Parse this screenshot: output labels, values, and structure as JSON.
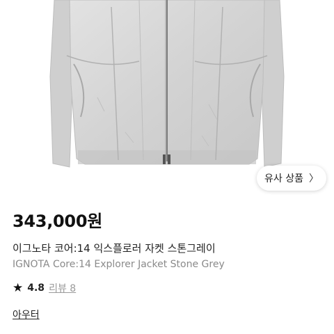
{
  "product": {
    "image_alt": "product-photo",
    "price": "343,000원",
    "title_ko": "이그노타 코어:14 익스플로러 자켓 스톤그레이",
    "title_en": "IGNOTA Core:14 Explorer Jacket Stone Grey",
    "rating": "4.8",
    "reviews_label": "리뷰 8",
    "category": "아우터"
  },
  "similar_button": {
    "label": "유사 상품",
    "icon": "chevron-right-icon"
  },
  "colors": {
    "jacket": "#d9d9d9",
    "text_primary": "#111111",
    "text_secondary": "#8a8a8a"
  }
}
